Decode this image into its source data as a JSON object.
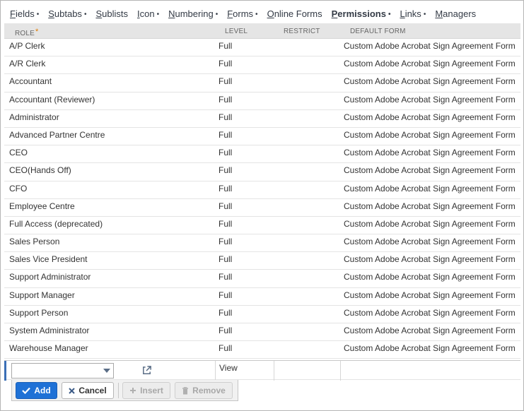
{
  "tabs": [
    {
      "label_ul": "F",
      "label_rest": "ields",
      "dot": "•",
      "active": false
    },
    {
      "label_ul": "S",
      "label_rest": "ubtabs",
      "dot": "•",
      "active": false
    },
    {
      "label_ul": "S",
      "label_rest": "ublists",
      "dot": "",
      "active": false
    },
    {
      "label_ul": "I",
      "label_rest": "con",
      "dot": "•",
      "active": false
    },
    {
      "label_ul": "N",
      "label_rest": "umbering",
      "dot": "•",
      "active": false
    },
    {
      "label_ul": "F",
      "label_rest": "orms",
      "dot": "•",
      "active": false
    },
    {
      "label_ul": "O",
      "label_rest": "nline Forms",
      "dot": "",
      "active": false
    },
    {
      "label_ul": "P",
      "label_rest": "ermissions",
      "dot": "•",
      "active": true
    },
    {
      "label_ul": "L",
      "label_rest": "inks",
      "dot": "•",
      "active": false
    },
    {
      "label_ul": "M",
      "label_rest": "anagers",
      "dot": "",
      "active": false
    }
  ],
  "table": {
    "headers": {
      "role": "Role",
      "role_required": "*",
      "level": "Level",
      "restrict": "Restrict",
      "default_form": "Default Form"
    },
    "rows": [
      {
        "role": "A/P Clerk",
        "level": "Full",
        "restrict": "",
        "form": "Custom Adobe Acrobat Sign Agreement Form"
      },
      {
        "role": "A/R Clerk",
        "level": "Full",
        "restrict": "",
        "form": "Custom Adobe Acrobat Sign Agreement Form"
      },
      {
        "role": "Accountant",
        "level": "Full",
        "restrict": "",
        "form": "Custom Adobe Acrobat Sign Agreement Form"
      },
      {
        "role": "Accountant (Reviewer)",
        "level": "Full",
        "restrict": "",
        "form": "Custom Adobe Acrobat Sign Agreement Form"
      },
      {
        "role": "Administrator",
        "level": "Full",
        "restrict": "",
        "form": "Custom Adobe Acrobat Sign Agreement Form"
      },
      {
        "role": "Advanced Partner Centre",
        "level": "Full",
        "restrict": "",
        "form": "Custom Adobe Acrobat Sign Agreement Form"
      },
      {
        "role": "CEO",
        "level": "Full",
        "restrict": "",
        "form": "Custom Adobe Acrobat Sign Agreement Form"
      },
      {
        "role": "CEO(Hands Off)",
        "level": "Full",
        "restrict": "",
        "form": "Custom Adobe Acrobat Sign Agreement Form"
      },
      {
        "role": "CFO",
        "level": "Full",
        "restrict": "",
        "form": "Custom Adobe Acrobat Sign Agreement Form"
      },
      {
        "role": "Employee Centre",
        "level": "Full",
        "restrict": "",
        "form": "Custom Adobe Acrobat Sign Agreement Form"
      },
      {
        "role": "Full Access (deprecated)",
        "level": "Full",
        "restrict": "",
        "form": "Custom Adobe Acrobat Sign Agreement Form"
      },
      {
        "role": "Sales Person",
        "level": "Full",
        "restrict": "",
        "form": "Custom Adobe Acrobat Sign Agreement Form"
      },
      {
        "role": "Sales Vice President",
        "level": "Full",
        "restrict": "",
        "form": "Custom Adobe Acrobat Sign Agreement Form"
      },
      {
        "role": "Support Administrator",
        "level": "Full",
        "restrict": "",
        "form": "Custom Adobe Acrobat Sign Agreement Form"
      },
      {
        "role": "Support Manager",
        "level": "Full",
        "restrict": "",
        "form": "Custom Adobe Acrobat Sign Agreement Form"
      },
      {
        "role": "Support Person",
        "level": "Full",
        "restrict": "",
        "form": "Custom Adobe Acrobat Sign Agreement Form"
      },
      {
        "role": "System Administrator",
        "level": "Full",
        "restrict": "",
        "form": "Custom Adobe Acrobat Sign Agreement Form"
      },
      {
        "role": "Warehouse Manager",
        "level": "Full",
        "restrict": "",
        "form": "Custom Adobe Acrobat Sign Agreement Form"
      }
    ]
  },
  "edit_row": {
    "role_select_value": "",
    "level_value": "View"
  },
  "buttons": {
    "add": "Add",
    "cancel": "Cancel",
    "insert": "Insert",
    "remove": "Remove"
  },
  "icons": {
    "add": "checkmark-icon",
    "cancel": "x-icon",
    "insert": "plus-icon",
    "remove": "trash-icon",
    "open": "external-link-icon",
    "select": "chevron-down-icon"
  },
  "colors": {
    "accent": "#1f71d6",
    "required_marker": "#e07b00",
    "header_bg": "#e5e5e5"
  }
}
